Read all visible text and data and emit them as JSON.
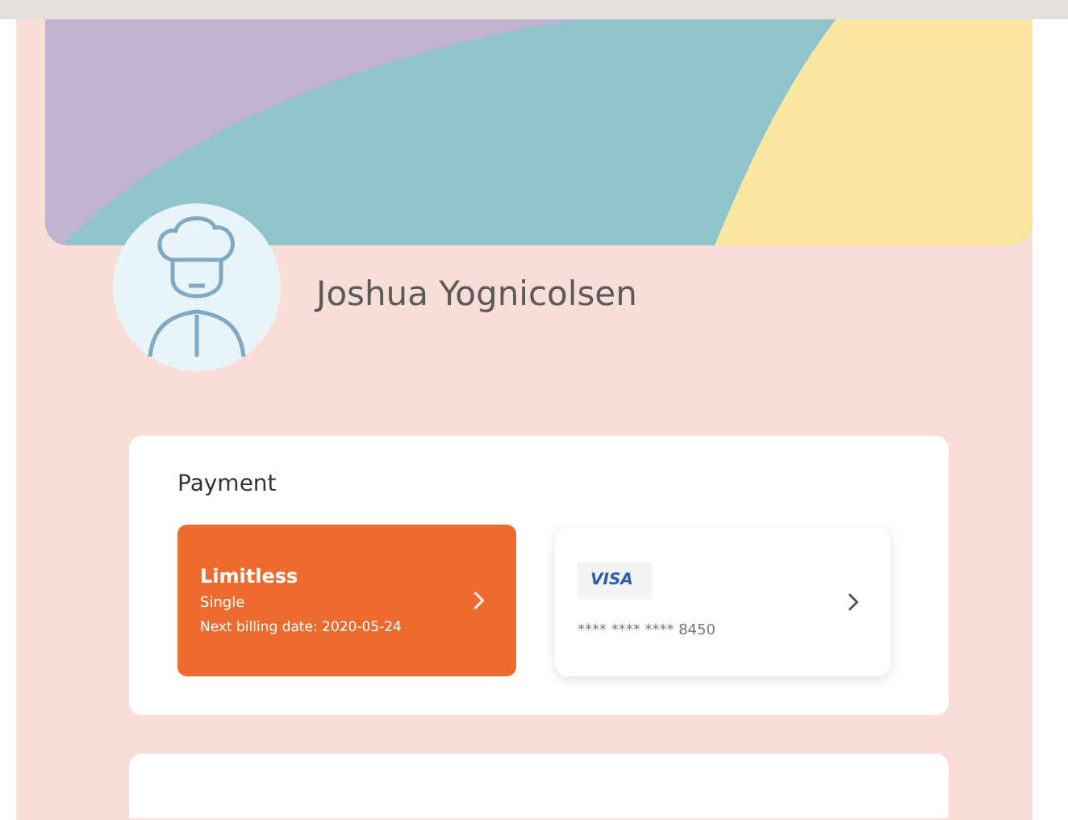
{
  "profile": {
    "name": "Joshua Yognicolsen"
  },
  "payment": {
    "title": "Payment",
    "subscription": {
      "plan": "Limitless",
      "type": "Single",
      "next_billing": "Next billing date: 2020-05-24"
    },
    "card": {
      "brand": "VISA",
      "number": "**** **** **** 8450"
    }
  }
}
